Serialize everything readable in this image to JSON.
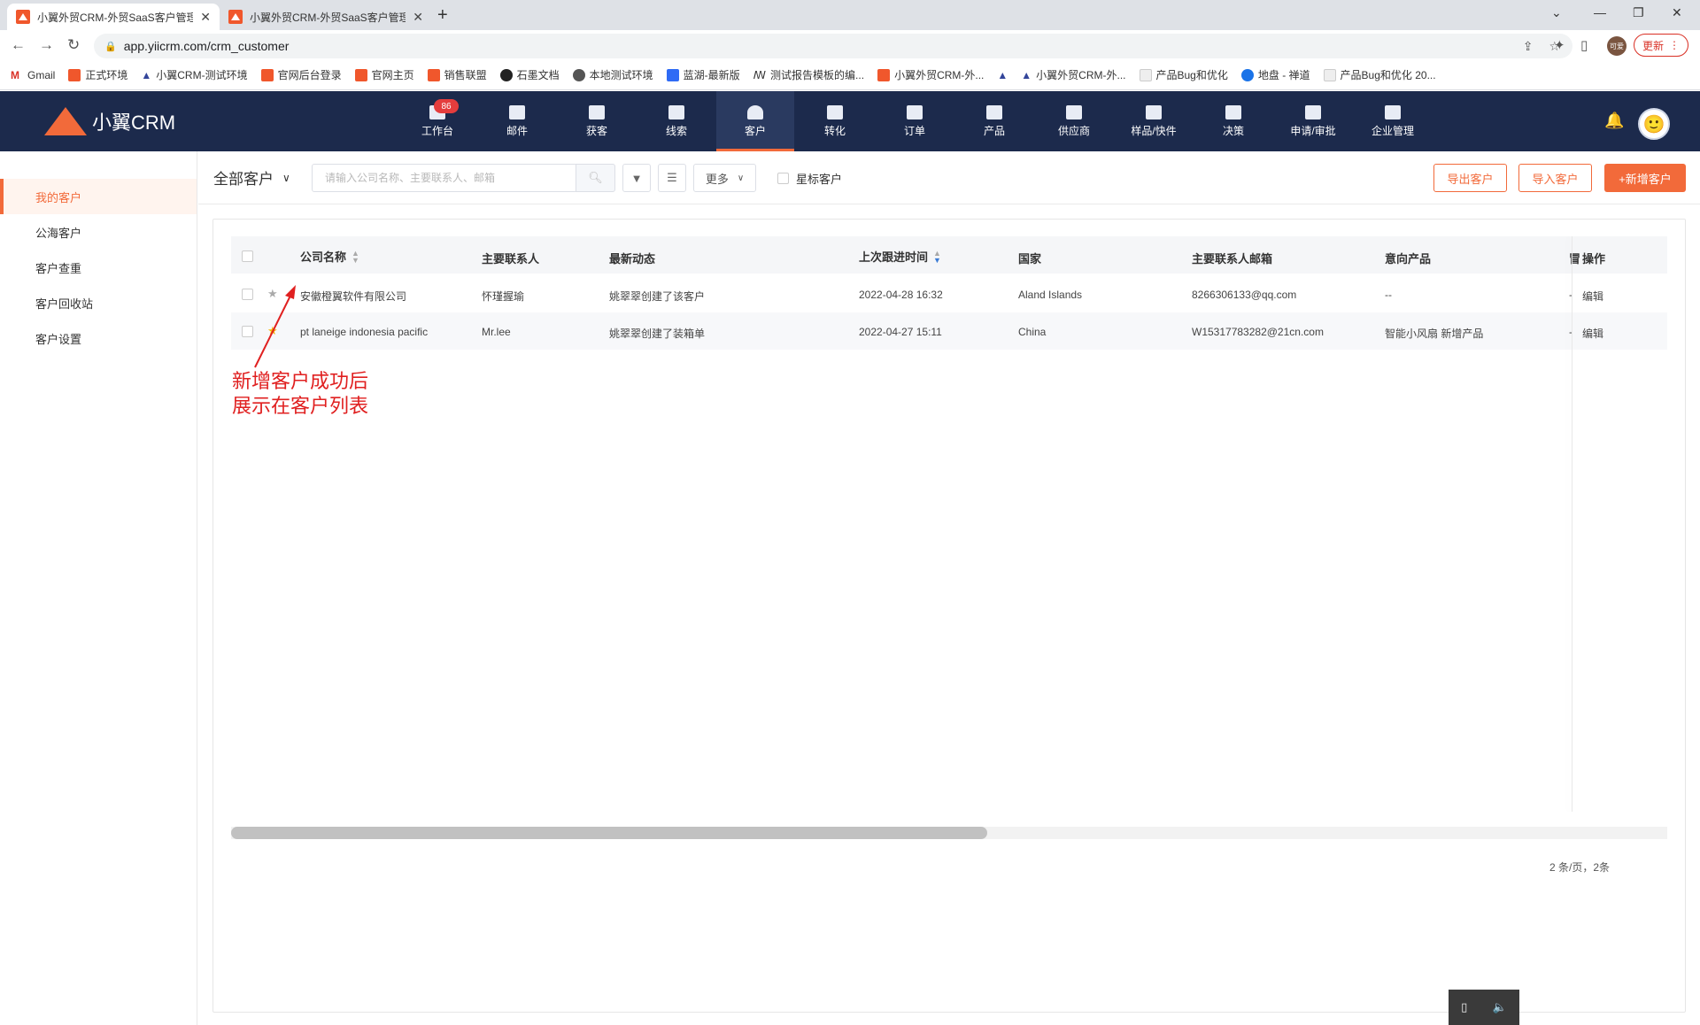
{
  "browser": {
    "tabs": [
      {
        "title": "小翼外贸CRM-外贸SaaS客户管理",
        "active": true
      },
      {
        "title": "小翼外贸CRM-外贸SaaS客户管理",
        "active": false
      }
    ],
    "url": "app.yiicrm.com/crm_customer",
    "profile_label": "可爱",
    "update_label": "更新",
    "bookmarks": [
      "Gmail",
      "正式环境",
      "小翼CRM-测试环境",
      "官网后台登录",
      "官网主页",
      "销售联盟",
      "石墨文档",
      "本地测试环境",
      "蓝湖-最新版",
      "测试报告模板的编...",
      "小翼外贸CRM-外...",
      "",
      "小翼外贸CRM-外...",
      "产品Bug和优化",
      "地盘 - 禅道",
      "产品Bug和优化 20..."
    ]
  },
  "app": {
    "logo_text": "小翼CRM",
    "nav": [
      {
        "label": "工作台",
        "icon": "dashboard-icon"
      },
      {
        "label": "邮件",
        "icon": "mail-icon"
      },
      {
        "label": "获客",
        "icon": "acquire-icon"
      },
      {
        "label": "线索",
        "icon": "leads-icon"
      },
      {
        "label": "客户",
        "icon": "customer-icon",
        "active": true
      },
      {
        "label": "转化",
        "icon": "funnel-icon"
      },
      {
        "label": "订单",
        "icon": "order-icon"
      },
      {
        "label": "产品",
        "icon": "product-icon"
      },
      {
        "label": "供应商",
        "icon": "supplier-icon"
      },
      {
        "label": "样品/快件",
        "icon": "flask-icon"
      },
      {
        "label": "决策",
        "icon": "chart-icon"
      },
      {
        "label": "申请/审批",
        "icon": "approval-icon"
      },
      {
        "label": "企业管理",
        "icon": "building-icon"
      }
    ],
    "badge": "86"
  },
  "sidebar": {
    "items": [
      {
        "label": "我的客户",
        "active": true
      },
      {
        "label": "公海客户"
      },
      {
        "label": "客户查重"
      },
      {
        "label": "客户回收站"
      },
      {
        "label": "客户设置"
      }
    ]
  },
  "filter": {
    "scope": "全部客户",
    "search_placeholder": "请输入公司名称、主要联系人、邮箱",
    "more": "更多",
    "star_label": "星标客户",
    "export": "导出客户",
    "import": "导入客户",
    "add": "+新增客户"
  },
  "table": {
    "headers": [
      "公司名称",
      "主要联系人",
      "最新动态",
      "上次跟进时间",
      "国家",
      "主要联系人邮箱",
      "意向产品",
      "",
      "操作"
    ],
    "rows": [
      {
        "company": "安徽橙翼软件有限公司",
        "contact": "怀瑾握瑜",
        "activity": "姚翠翠创建了该客户",
        "last_follow": "2022-04-28 16:32",
        "country": "Aland Islands",
        "email": "8266306133@qq.com",
        "product": "--",
        "extra": "-",
        "op": "编辑",
        "starred": false
      },
      {
        "company": "pt laneige indonesia pacific",
        "contact": "Mr.lee",
        "activity": "姚翠翠创建了装箱单",
        "last_follow": "2022-04-27 15:11",
        "country": "China",
        "email": "W15317783282@21cn.com",
        "product": "智能小风扇 新增产品",
        "extra": "-",
        "op": "编辑",
        "starred": true
      }
    ]
  },
  "pager": "2 条/页，2条",
  "annotation": "新增客户成功后\n展示在客户列表",
  "colors": {
    "accent": "#f26a3a",
    "header": "#1c2a4c",
    "annotation": "#e02020"
  }
}
